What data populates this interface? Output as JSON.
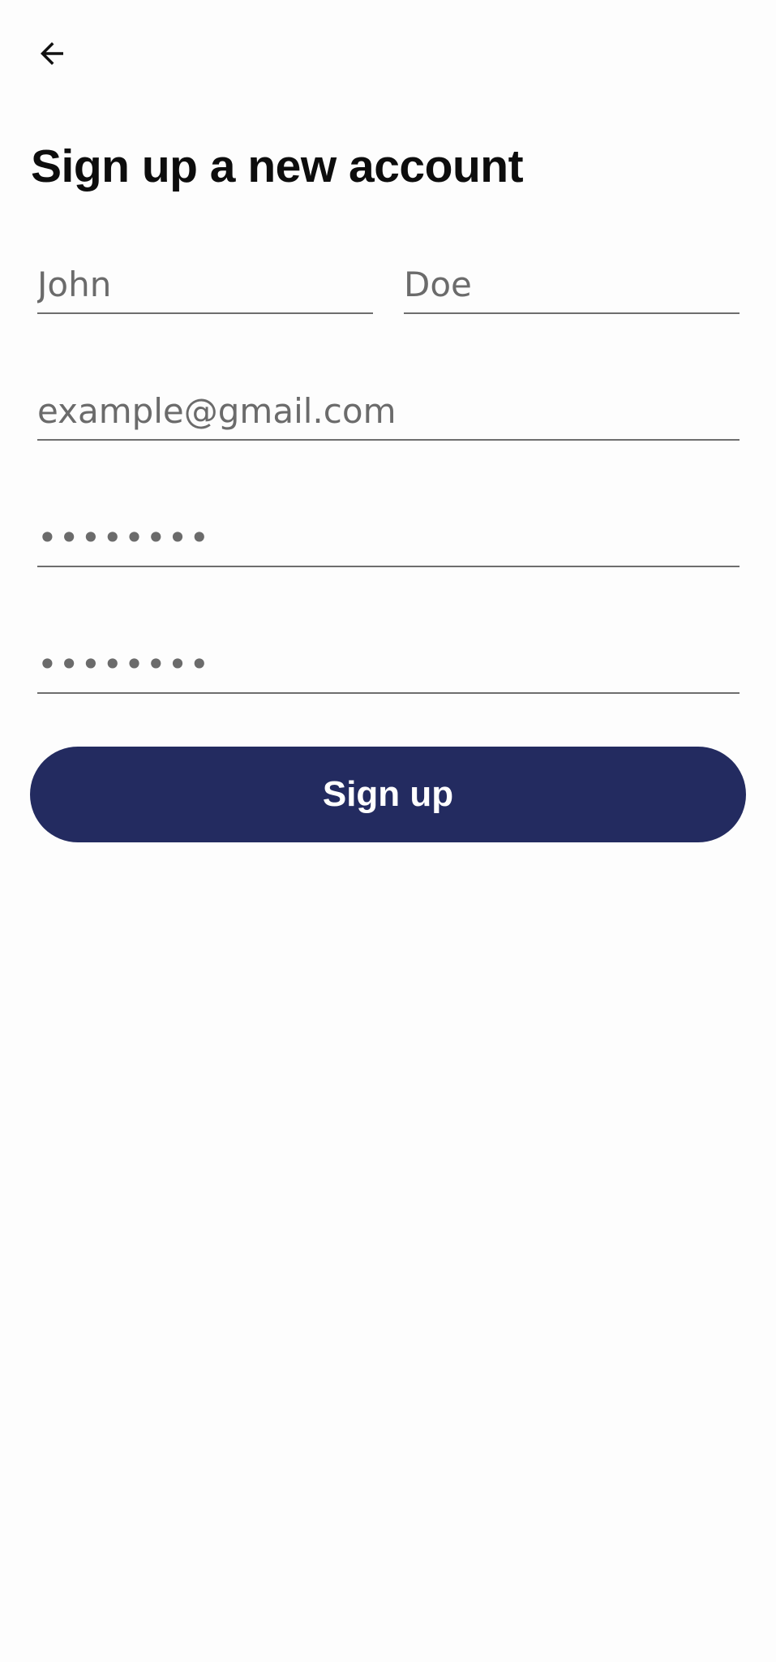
{
  "header": {
    "back_icon": "arrow-left-icon"
  },
  "page": {
    "title": "Sign up a new account"
  },
  "form": {
    "first_name": {
      "placeholder": "John",
      "value": ""
    },
    "last_name": {
      "placeholder": "Doe",
      "value": ""
    },
    "email": {
      "placeholder": "example@gmail.com",
      "value": ""
    },
    "password": {
      "placeholder": "••••••••",
      "value": ""
    },
    "confirm_password": {
      "placeholder": "••••••••",
      "value": ""
    },
    "submit_label": "Sign up"
  },
  "colors": {
    "background": "#fdfdfd",
    "button": "#232b60",
    "button_text": "#ffffff",
    "title": "#0d0d0d",
    "placeholder": "#6b6b6b",
    "underline": "#6e6e6e"
  }
}
